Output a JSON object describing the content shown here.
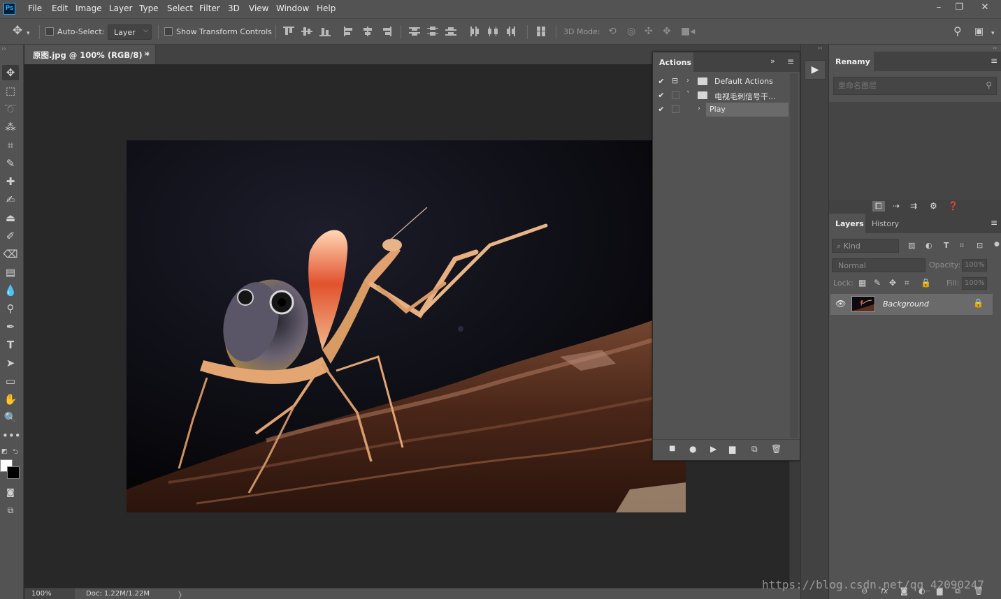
{
  "menubar": {
    "logo": "Ps",
    "items": [
      "File",
      "Edit",
      "Image",
      "Layer",
      "Type",
      "Select",
      "Filter",
      "3D",
      "View",
      "Window",
      "Help"
    ],
    "window_controls": [
      "–",
      "❐",
      "✕"
    ]
  },
  "options": {
    "auto_select_label": "Auto-Select:",
    "auto_select_checked": false,
    "auto_select_target": "Layer",
    "show_transform_label": "Show Transform Controls",
    "show_transform_checked": false,
    "three_d_mode_label": "3D Mode:"
  },
  "document": {
    "tab_label": "原图.jpg @ 100% (RGB/8) *",
    "close_icon": "×"
  },
  "status": {
    "zoom": "100%",
    "doc_info": "Doc: 1.22M/1.22M",
    "arrow": "〉"
  },
  "actions_panel": {
    "tab_label": "Actions",
    "rows": [
      {
        "checked": true,
        "twirl": "›",
        "label": "Default Actions",
        "kind": "set"
      },
      {
        "checked": true,
        "twirl": "˅",
        "label": "电视毛刺信号干...",
        "kind": "set"
      },
      {
        "checked": true,
        "twirl": "›",
        "label": "Play",
        "kind": "action"
      }
    ],
    "footer_icons": [
      "stop-icon",
      "record-icon",
      "play-icon",
      "new-set-icon",
      "new-action-icon",
      "delete-icon"
    ]
  },
  "renamy_panel": {
    "tab_label": "Renamy",
    "search_placeholder": "重命名图层"
  },
  "layers_panel": {
    "tabs": [
      "Layers",
      "History"
    ],
    "filter_kind": "⌕ Kind",
    "blend_mode": "Normal",
    "opacity_label": "Opacity:",
    "opacity_value": "100%",
    "lock_label": "Lock:",
    "fill_label": "Fill:",
    "fill_value": "100%",
    "layers": [
      {
        "name": "Background",
        "visible": true,
        "locked": true
      }
    ]
  },
  "watermark": "https://blog.csdn.net/qq_42090247",
  "colors": {
    "accent": "#31a8ff",
    "panel": "#535353",
    "canvas_bg": "#282828",
    "foreground_swatch": "#ffffff",
    "background_swatch": "#000000"
  }
}
